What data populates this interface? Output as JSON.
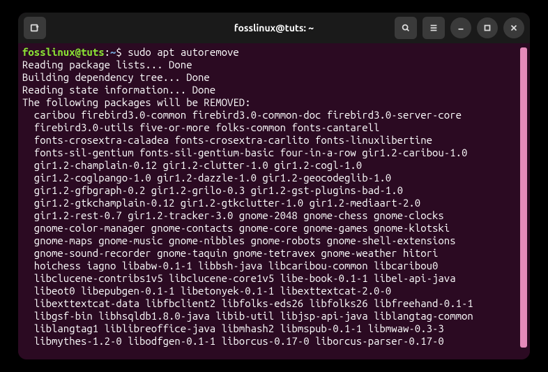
{
  "titlebar": {
    "title": "fosslinux@tuts: ~"
  },
  "prompt": {
    "user_host": "fosslinux@tuts",
    "separator": ":",
    "path": "~",
    "symbol": "$"
  },
  "command": "sudo apt autoremove",
  "output_lines": [
    "Reading package lists... Done",
    "Building dependency tree... Done",
    "Reading state information... Done",
    "The following packages will be REMOVED:"
  ],
  "package_lines": [
    "caribou firebird3.0-common firebird3.0-common-doc firebird3.0-server-core",
    "firebird3.0-utils five-or-more folks-common fonts-cantarell",
    "fonts-crosextra-caladea fonts-crosextra-carlito fonts-linuxlibertine",
    "fonts-sil-gentium fonts-sil-gentium-basic four-in-a-row gir1.2-caribou-1.0",
    "gir1.2-champlain-0.12 gir1.2-clutter-1.0 gir1.2-cogl-1.0",
    "gir1.2-coglpango-1.0 gir1.2-dazzle-1.0 gir1.2-geocodeglib-1.0",
    "gir1.2-gfbgraph-0.2 gir1.2-grilo-0.3 gir1.2-gst-plugins-bad-1.0",
    "gir1.2-gtkchamplain-0.12 gir1.2-gtkclutter-1.0 gir1.2-mediaart-2.0",
    "gir1.2-rest-0.7 gir1.2-tracker-3.0 gnome-2048 gnome-chess gnome-clocks",
    "gnome-color-manager gnome-contacts gnome-core gnome-games gnome-klotski",
    "gnome-maps gnome-music gnome-nibbles gnome-robots gnome-shell-extensions",
    "gnome-sound-recorder gnome-taquin gnome-tetravex gnome-weather hitori",
    "hoichess iagno libabw-0.1-1 libbsh-java libcaribou-common libcaribou0",
    "libclucene-contribs1v5 libclucene-core1v5 libe-book-0.1-1 libel-api-java",
    "libeot0 libepubgen-0.1-1 libetonyek-0.1-1 libexttextcat-2.0-0",
    "libexttextcat-data libfbclient2 libfolks-eds26 libfolks26 libfreehand-0.1-1",
    "libgsf-bin libhsqldb1.8.0-java libib-util libjsp-api-java liblangtag-common",
    "liblangtag1 liblibreoffice-java libmhash2 libmspub-0.1-1 libmwaw-0.3-3",
    "libmythes-1.2-0 libodfgen-0.1-1 liborcus-0.17-0 liborcus-parser-0.17-0"
  ]
}
